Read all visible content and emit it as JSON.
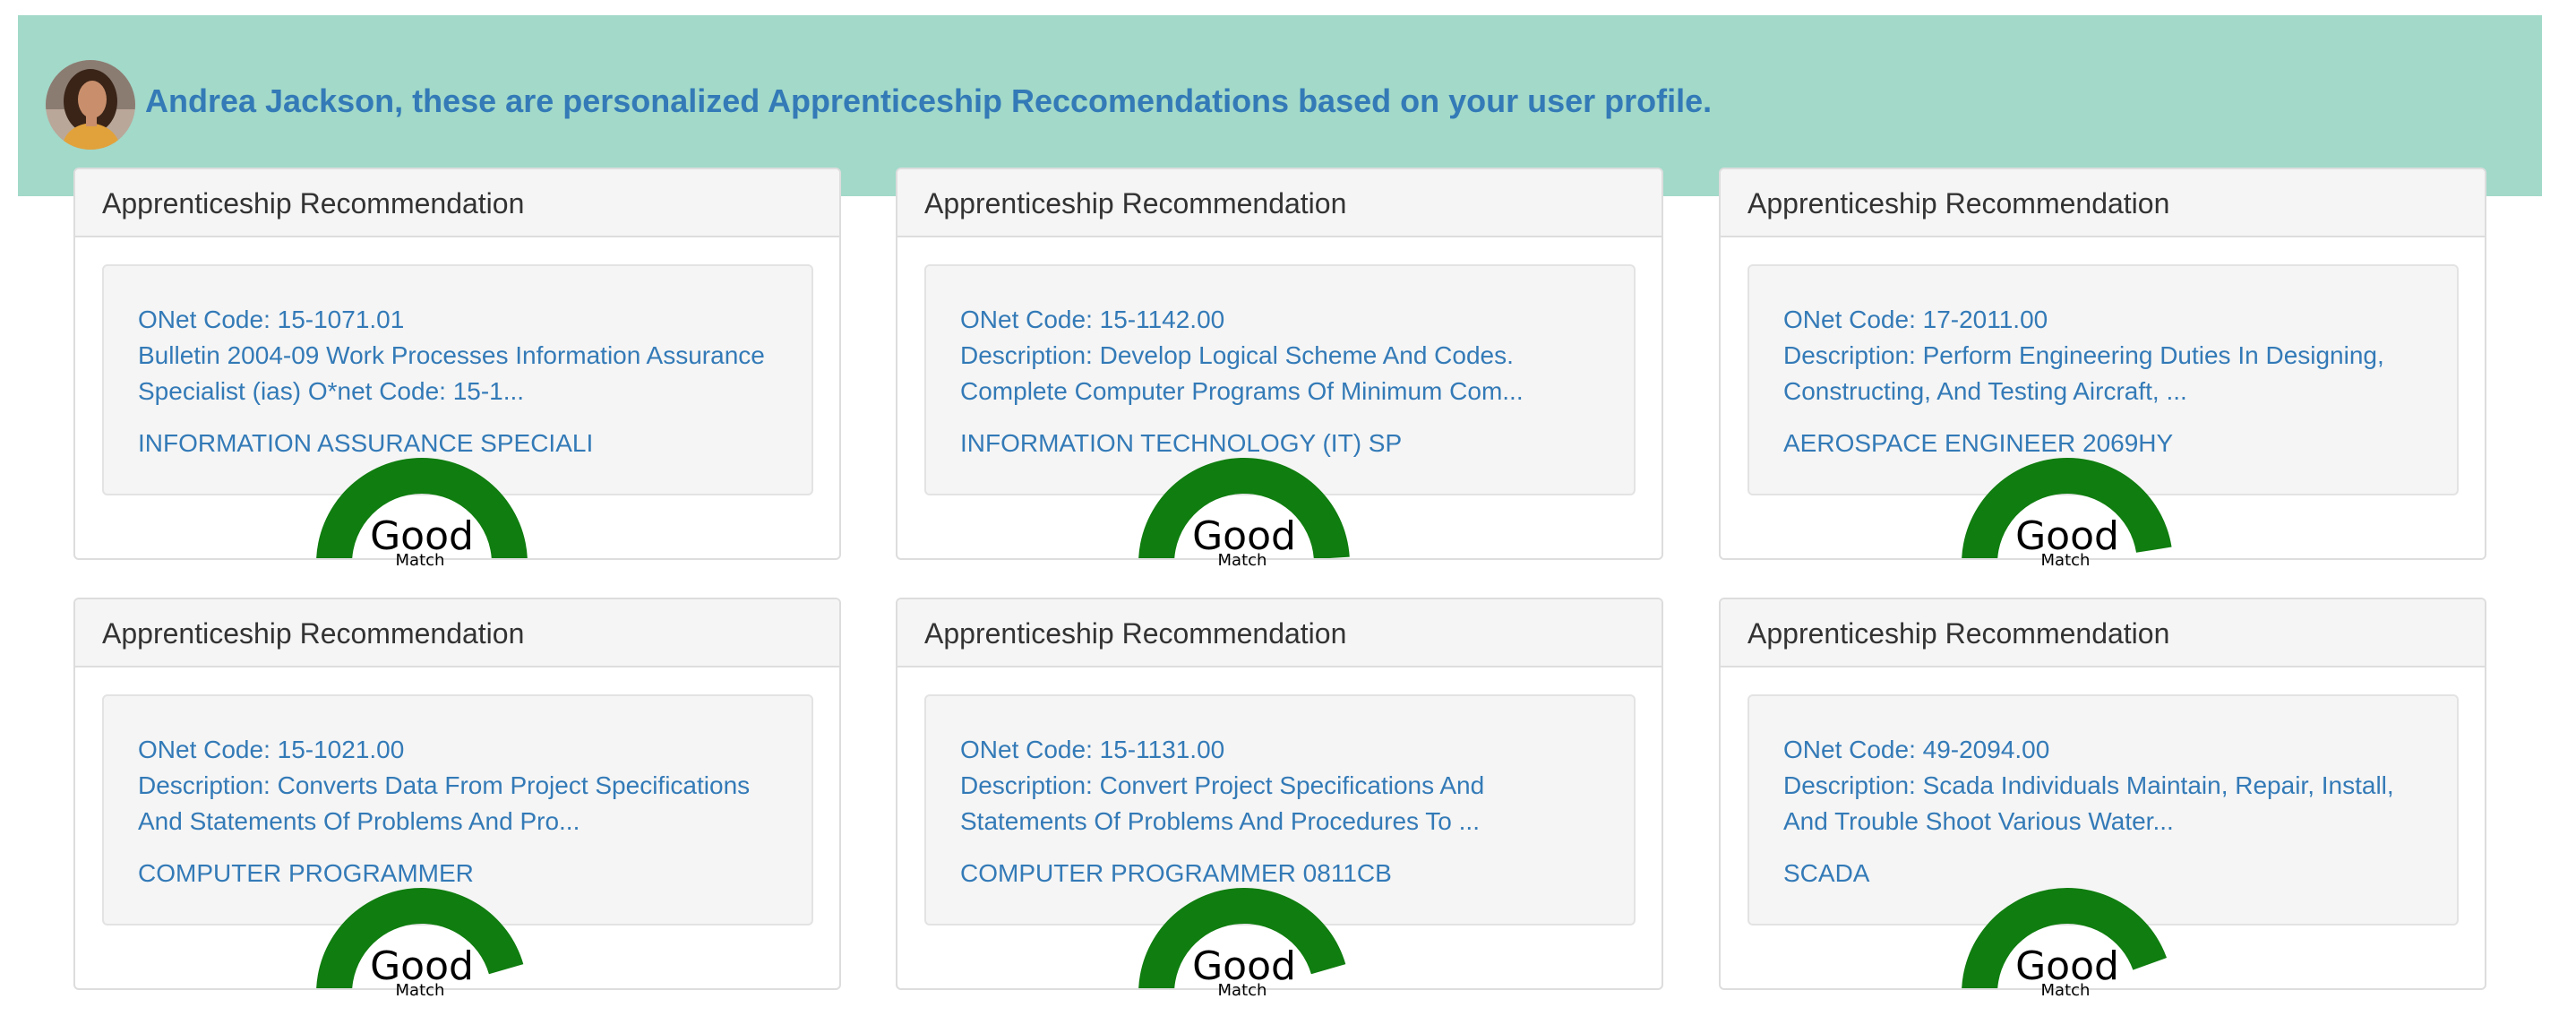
{
  "header": {
    "message": "Andrea Jackson, these are personalized Apprenticeship Reccomendations based on your user profile."
  },
  "colors": {
    "banner": "#a2d9c9",
    "link_text": "#337ab7",
    "gauge_good": "#0f7d0f"
  },
  "cards": [
    {
      "heading": "Apprenticeship Recommendation",
      "onet": "ONet Code: 15-1071.01",
      "description": "Bulletin 2004-09 Work Processes Information Assurance Specialist (ias) O*net Code: 15-1...",
      "title": "INFORMATION ASSURANCE SPECIALI",
      "match": "Good",
      "match_sub": "Match",
      "match_level": 1.0
    },
    {
      "heading": "Apprenticeship Recommendation",
      "onet": "ONet Code: 15-1142.00",
      "description": "Description: Develop Logical Scheme And Codes. Complete Computer Programs Of Minimum Com...",
      "title": "INFORMATION TECHNOLOGY (IT) SP",
      "match": "Good",
      "match_sub": "Match",
      "match_level": 0.98
    },
    {
      "heading": "Apprenticeship Recommendation",
      "onet": "ONet Code: 17-2011.00",
      "description": "Description: Perform Engineering Duties In Designing, Constructing, And Testing Aircraft, ...",
      "title": "AEROSPACE ENGINEER 2069HY",
      "match": "Good",
      "match_sub": "Match",
      "match_level": 0.95
    },
    {
      "heading": "Apprenticeship Recommendation",
      "onet": "ONet Code: 15-1021.00",
      "description": "Description: Converts Data From Project Specifications And Statements Of Problems And Pro...",
      "title": "COMPUTER PROGRAMMER",
      "match": "Good",
      "match_sub": "Match",
      "match_level": 0.91
    },
    {
      "heading": "Apprenticeship Recommendation",
      "onet": "ONet Code: 15-1131.00",
      "description": "Description: Convert Project Specifications And Statements Of Problems And Procedures To ...",
      "title": "COMPUTER PROGRAMMER 0811CB",
      "match": "Good",
      "match_sub": "Match",
      "match_level": 0.91
    },
    {
      "heading": "Apprenticeship Recommendation",
      "onet": "ONet Code: 49-2094.00",
      "description": "Description: Scada Individuals Maintain, Repair, Install, And Trouble Shoot Various Water...",
      "title": "SCADA",
      "match": "Good",
      "match_sub": "Match",
      "match_level": 0.89
    }
  ]
}
